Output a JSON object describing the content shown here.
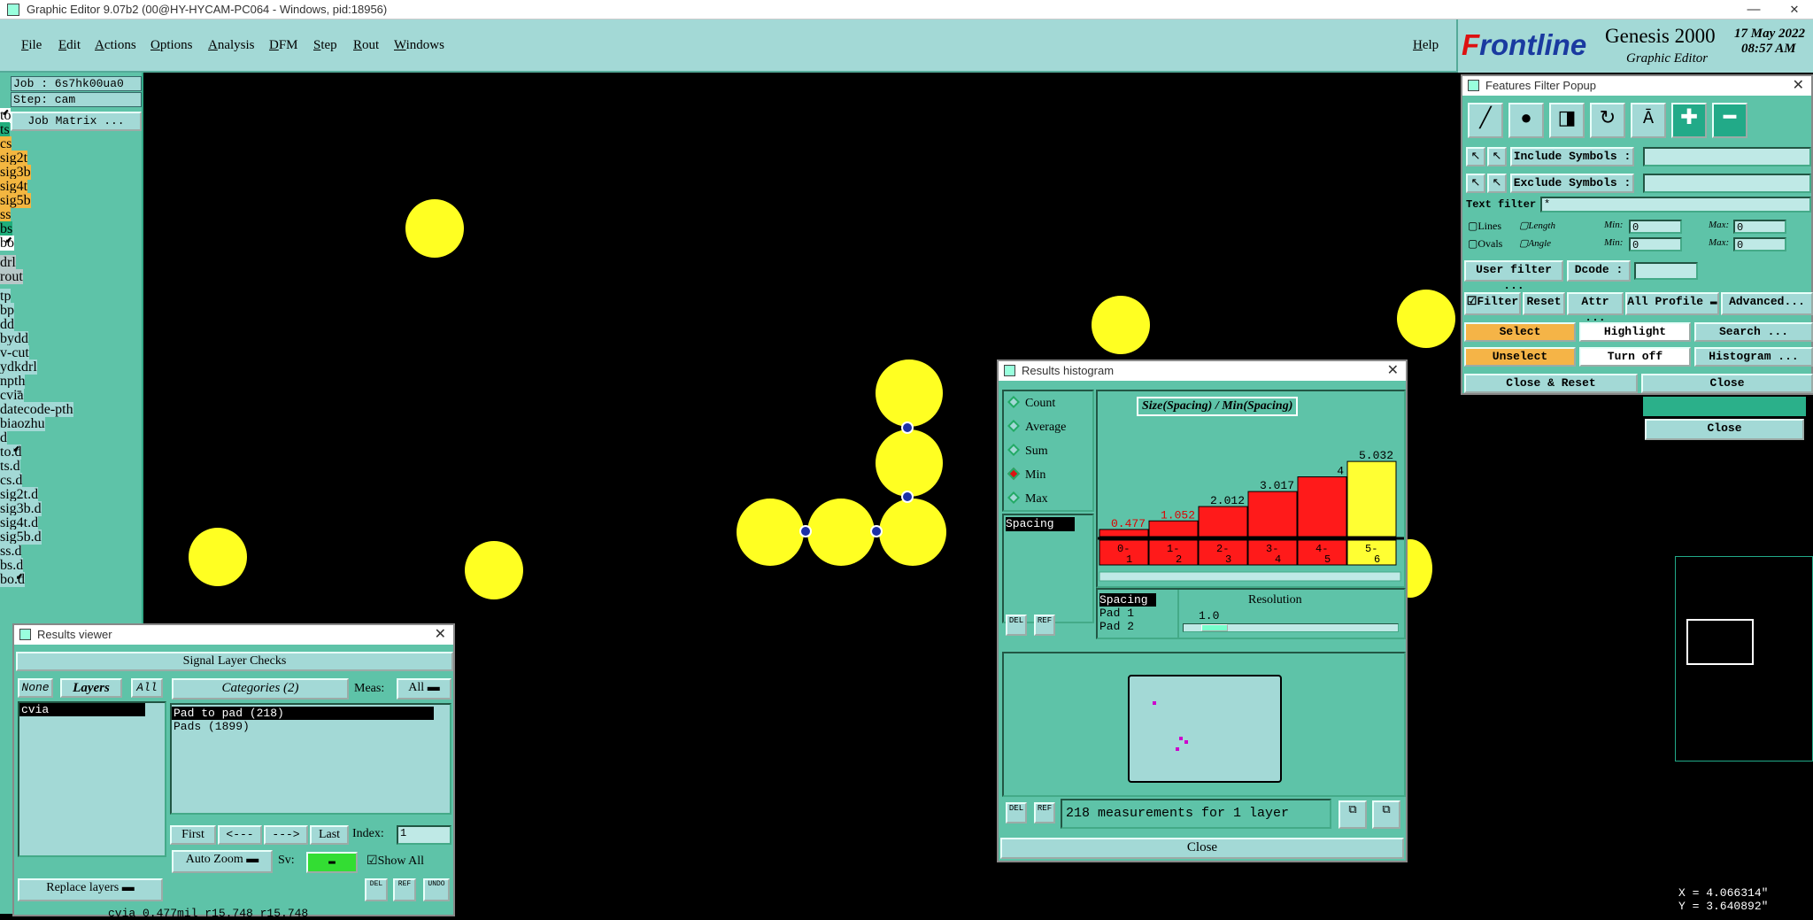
{
  "window": {
    "title": "Graphic Editor 9.07b2 (00@HY-HYCAM-PC064 - Windows, pid:18956)",
    "min": "—",
    "max": "☐",
    "close": "✕"
  },
  "menu": {
    "items": [
      "File",
      "Edit",
      "Actions",
      "Options",
      "Analysis",
      "DFM",
      "Step",
      "Rout",
      "Windows"
    ],
    "help": "Help"
  },
  "brand": {
    "logo_f": "F",
    "logo_rest": "rontline",
    "product": "Genesis 2000",
    "subtitle": "Graphic Editor",
    "date": "17 May 2022",
    "time": "08:57 AM"
  },
  "left": {
    "job": "Job : 6s7hk00ua0",
    "step": "Step: cam",
    "job_matrix": "Job Matrix ...",
    "layers": [
      {
        "name": "to",
        "color": "#ffffff",
        "mark": "⬋"
      },
      {
        "name": "ts",
        "color": "#1fae7c"
      },
      {
        "name": "cs",
        "color": "#f3b640"
      },
      {
        "name": "sig2t",
        "color": "#f3b640"
      },
      {
        "name": "sig3b",
        "color": "#f3b640"
      },
      {
        "name": "sig4t",
        "color": "#f3b640"
      },
      {
        "name": "sig5b",
        "color": "#f3b640"
      },
      {
        "name": "ss",
        "color": "#f3b640"
      },
      {
        "name": "bs",
        "color": "#1fae7c"
      },
      {
        "name": "bo",
        "color": "#ffffff",
        "mark": "⬋"
      },
      {
        "name": "drl",
        "color": "#b8c8c8"
      },
      {
        "name": "rout",
        "color": "#b8c8c8"
      },
      {
        "name": "tp",
        "color": "#a3d9d6"
      },
      {
        "name": "bp",
        "color": "#a3d9d6"
      },
      {
        "name": "dd",
        "color": "#a3d9d6"
      },
      {
        "name": "bydd",
        "color": "#a3d9d6"
      },
      {
        "name": "v-cut",
        "color": "#a3d9d6"
      },
      {
        "name": "ydkdrl",
        "color": "#a3d9d6"
      },
      {
        "name": "npth",
        "color": "#a3d9d6"
      },
      {
        "name": "cvia",
        "color": "#a3d9d6",
        "mark": "≡"
      },
      {
        "name": "datecode-pth",
        "color": "#a3d9d6"
      },
      {
        "name": "biaozhu",
        "color": "#a3d9d6"
      },
      {
        "name": "d",
        "color": "#a3d9d6"
      },
      {
        "name": "to.d",
        "color": "#a3d9d6",
        "mark": "⬋"
      },
      {
        "name": "ts.d",
        "color": "#a3d9d6"
      },
      {
        "name": "cs.d",
        "color": "#a3d9d6"
      },
      {
        "name": "sig2t.d",
        "color": "#a3d9d6"
      },
      {
        "name": "sig3b.d",
        "color": "#a3d9d6"
      },
      {
        "name": "sig4t.d",
        "color": "#a3d9d6"
      },
      {
        "name": "sig5b.d",
        "color": "#a3d9d6"
      },
      {
        "name": "ss.d",
        "color": "#a3d9d6"
      },
      {
        "name": "bs.d",
        "color": "#a3d9d6"
      },
      {
        "name": "bo.d",
        "color": "#a3d9d6",
        "mark": "⬋"
      }
    ]
  },
  "filter": {
    "title": "Features Filter Popup",
    "include_label": "Include Symbols :",
    "exclude_label": "Exclude Symbols :",
    "text_filter_label": "Text filter",
    "text_filter_value": "*",
    "lines": "Lines",
    "ovals": "Ovals",
    "length": "Length",
    "angle": "Angle",
    "min": "Min:",
    "max": "Max:",
    "zero": "0",
    "user_filter": "User filter ...",
    "dcode": "Dcode :",
    "filter": "Filter",
    "reset": "Reset",
    "attr": "Attr ...",
    "all_profile": "All Profile",
    "advanced": "Advanced...",
    "select": "Select",
    "highlight": "Highlight",
    "search": "Search ...",
    "unselect": "Unselect",
    "turn_off": "Turn off",
    "histogram": "Histogram ...",
    "close_reset": "Close & Reset",
    "close": "Close",
    "close2": "Close"
  },
  "histogram": {
    "title": "Results histogram",
    "modes": [
      "Count",
      "Average",
      "Sum",
      "Min",
      "Max"
    ],
    "selected_mode": "Min",
    "list_item": "Spacing",
    "chart_title": "Size(Spacing) / Min(Spacing)",
    "params": [
      "Spacing",
      "Pad 1",
      "Pad 2"
    ],
    "resolution_label": "Resolution",
    "resolution_value": "1.0",
    "measurements": "218 measurements for 1 layer",
    "close": "Close",
    "del": "DEL",
    "ref": "REF"
  },
  "chart_data": {
    "type": "bar",
    "title": "Size(Spacing) / Min(Spacing)",
    "categories": [
      "0-1",
      "1-2",
      "2-3",
      "3-4",
      "4-5",
      "5-6"
    ],
    "values": [
      0.477,
      1.052,
      2.012,
      3.017,
      4,
      5.032
    ],
    "value_labels": [
      "0.477",
      "1.052",
      "2.012",
      "3.017",
      "4",
      "5.032"
    ],
    "highlight_index": 5,
    "bar_color": "#ff1a1a",
    "highlight_color": "#ffff33"
  },
  "results": {
    "title": "Results viewer",
    "heading": "Signal Layer Checks",
    "none": "None",
    "layers": "Layers",
    "all": "All",
    "layer_item": "cvia",
    "categories": "Categories (2)",
    "meas_label": "Meas:",
    "meas_value": "All",
    "cat_items": [
      "Pad to pad (218)",
      "Pads (1899)"
    ],
    "first": "First",
    "prev": "<---",
    "next": "--->",
    "last": "Last",
    "index_label": "Index:",
    "index_value": "1",
    "auto_zoom": "Auto Zoom",
    "sv_label": "Sv:",
    "show_all": "Show All",
    "replace_layers": "Replace layers",
    "del": "DEL",
    "ref": "REF",
    "undo": "UNDO",
    "bottom_text": "cvia 0.477mil r15.748 r15.748"
  },
  "coords": {
    "x": "X = 4.066314\"",
    "y": "Y = 3.640892\""
  }
}
